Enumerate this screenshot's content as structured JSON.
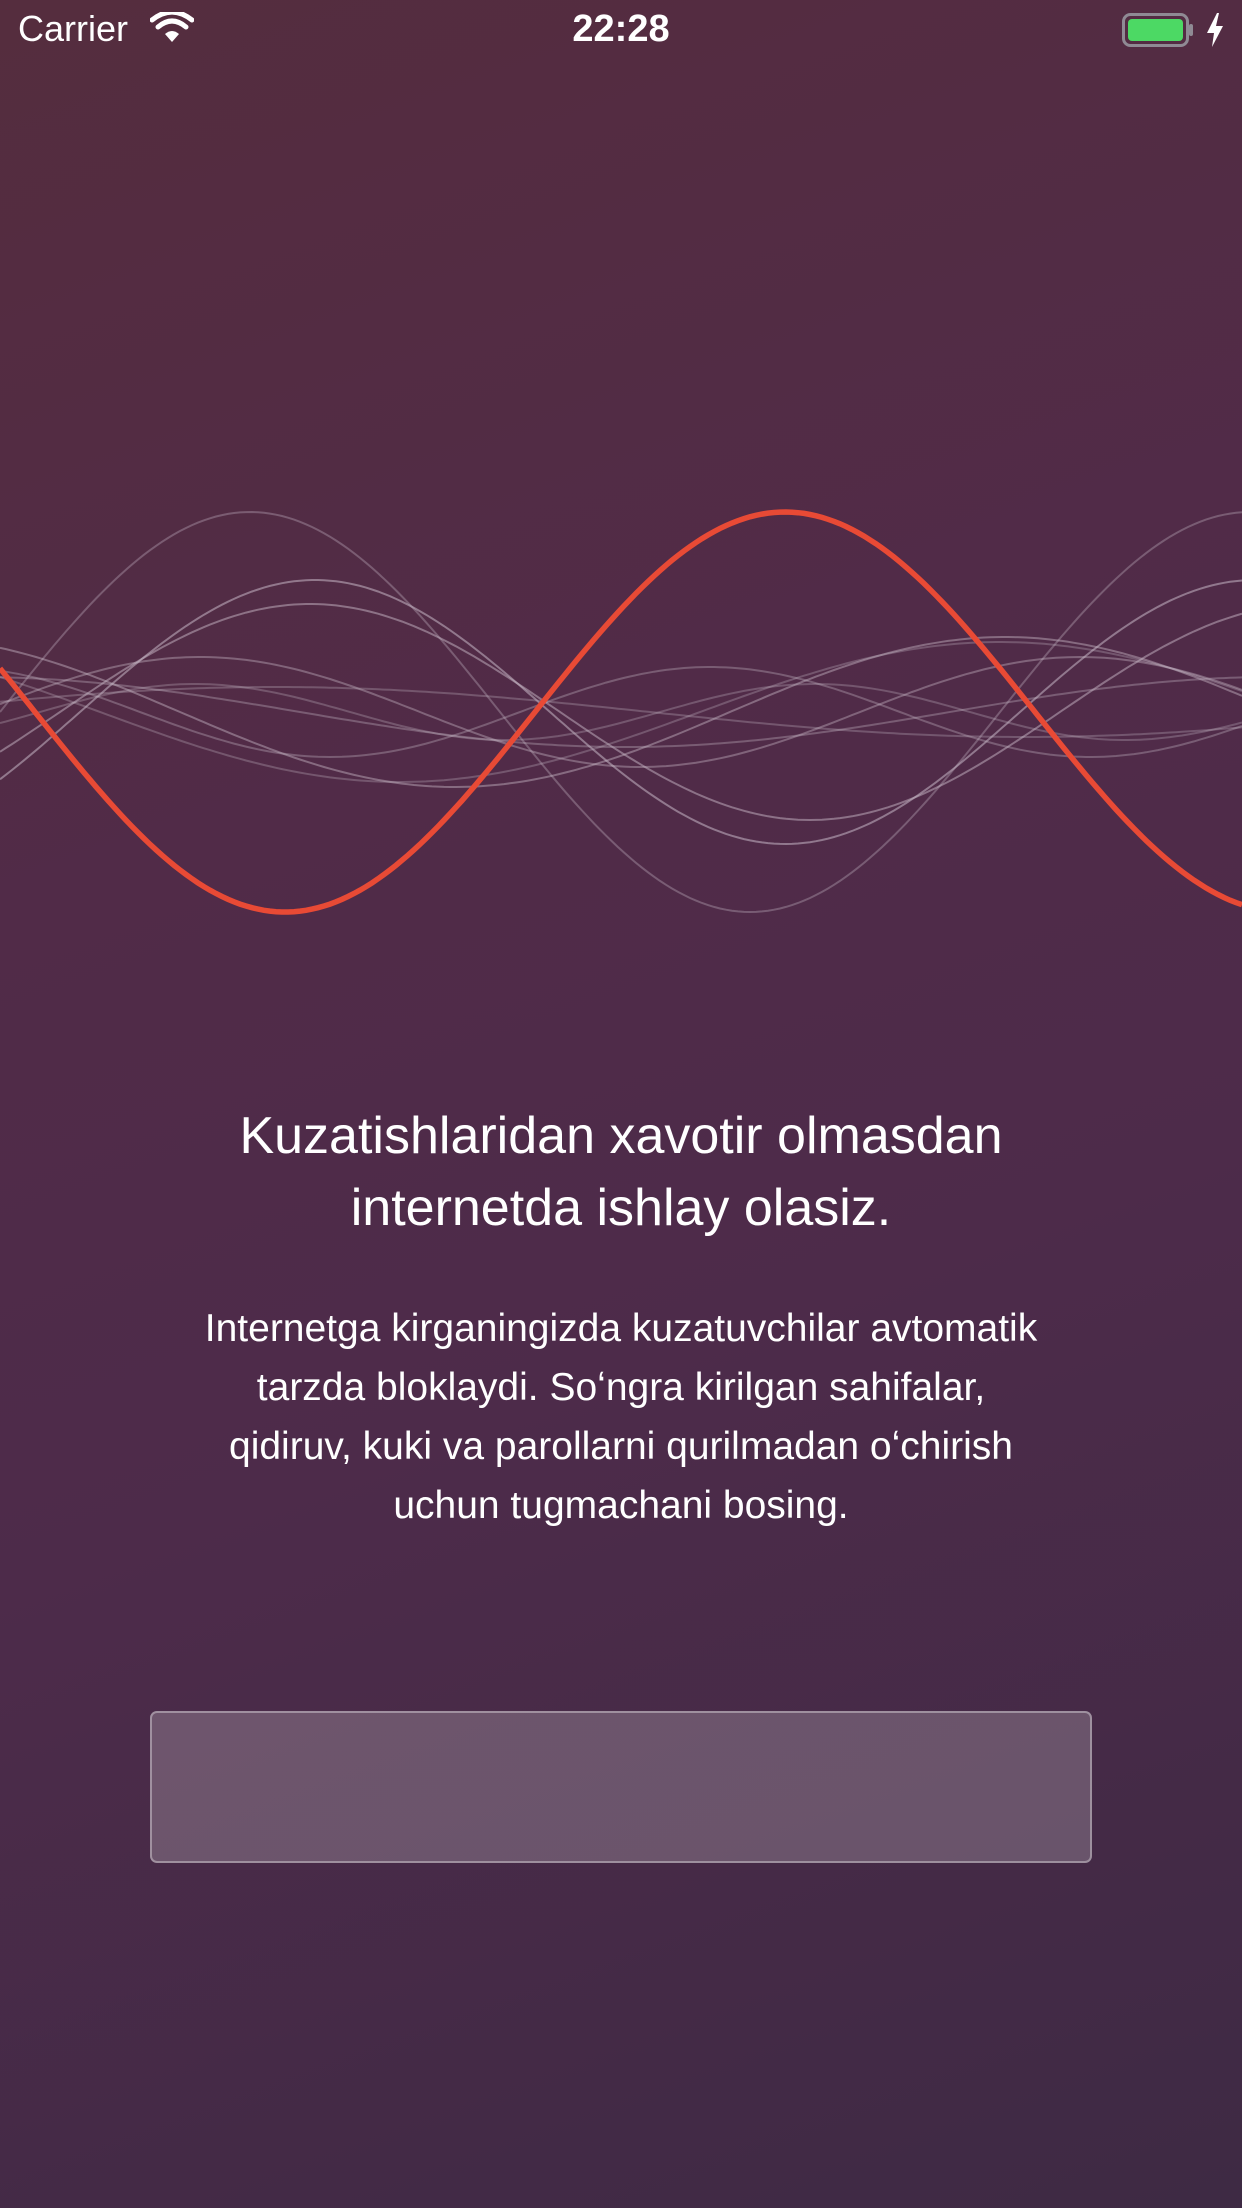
{
  "status_bar": {
    "carrier": "Carrier",
    "time": "22:28",
    "wifi_icon": "wifi-icon",
    "battery_icon": "battery-icon",
    "charging_icon": "charging-bolt-icon",
    "battery_level": 1.0,
    "battery_color": "#4cd964"
  },
  "onboarding": {
    "title_line1": "Kuzatishlaridan xavotir olmasdan",
    "title_line2": "internetda ishlay olasiz.",
    "description_lines": [
      "Internetga kirganingizda kuzatuvchilar avtomatik",
      "tarzda bloklaydi. Soʻngra kirilgan sahifalar,",
      "qidiruv, kuki va parollarni qurilmadan oʻchirish",
      "uchun tugmachani bosing."
    ],
    "button_label": ""
  },
  "colors": {
    "accent_wave": "#e84a35",
    "secondary_waves": "#c7b8c6"
  }
}
